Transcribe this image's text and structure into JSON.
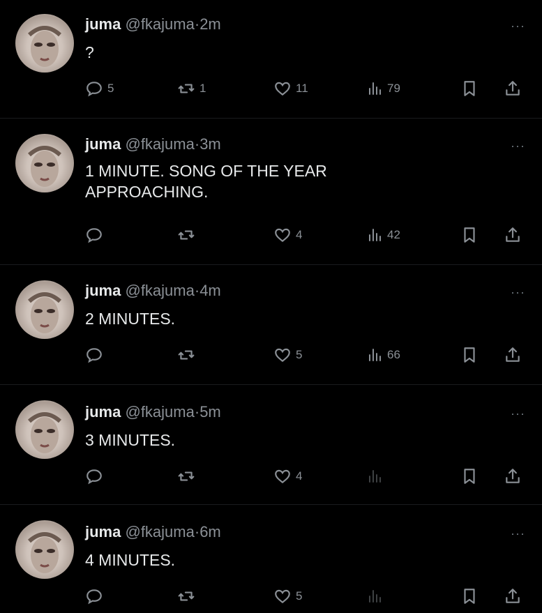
{
  "tweets": [
    {
      "name": "juma",
      "handle": "@fkajuma",
      "dot": "·",
      "time": "2m",
      "text": [
        "?"
      ],
      "replies": "5",
      "retweets": "1",
      "likes": "11",
      "views": "79"
    },
    {
      "name": "juma",
      "handle": "@fkajuma",
      "dot": "·",
      "time": "3m",
      "text": [
        "1 MINUTE. SONG OF THE YEAR",
        "APPROACHING."
      ],
      "replies": "",
      "retweets": "",
      "likes": "4",
      "views": "42"
    },
    {
      "name": "juma",
      "handle": "@fkajuma",
      "dot": "·",
      "time": "4m",
      "text": [
        "2 MINUTES."
      ],
      "replies": "",
      "retweets": "",
      "likes": "5",
      "views": "66"
    },
    {
      "name": "juma",
      "handle": "@fkajuma",
      "dot": "·",
      "time": "5m",
      "text": [
        "3 MINUTES."
      ],
      "replies": "",
      "retweets": "",
      "likes": "4",
      "views": ""
    },
    {
      "name": "juma",
      "handle": "@fkajuma",
      "dot": "·",
      "time": "6m",
      "text": [
        "4 MINUTES."
      ],
      "replies": "",
      "retweets": "",
      "likes": "5",
      "views": ""
    }
  ],
  "more_label": "···",
  "icons": {
    "reply": "reply-icon",
    "retweet": "retweet-icon",
    "like": "heart-icon",
    "views": "views-bar-chart-icon",
    "bookmark": "bookmark-icon",
    "share": "share-icon"
  },
  "colors": {
    "background": "#000000",
    "text": "#e7e9ea",
    "muted": "#8b9096"
  }
}
